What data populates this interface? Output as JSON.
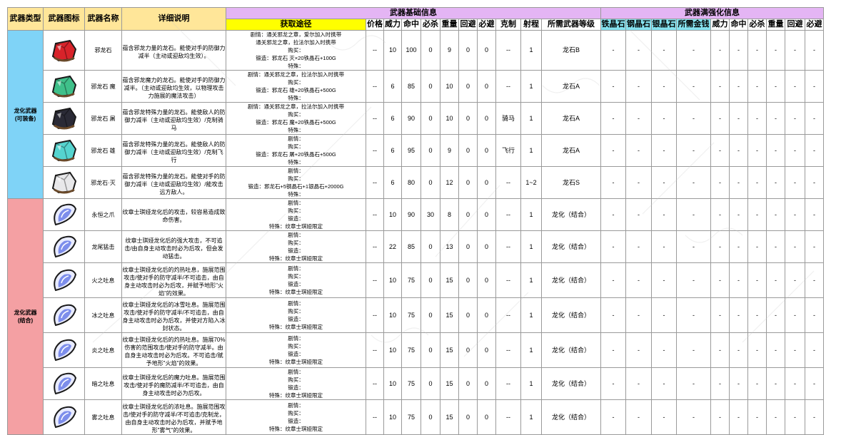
{
  "headers": {
    "type": "武器类型",
    "icon": "武器图标",
    "name": "武器名称",
    "desc": "详细说明",
    "basic_group": "武器基础信息",
    "enhance_group": "武器满强化信息",
    "route": "获取途径",
    "basic_cols": [
      "价格",
      "威力",
      "命中",
      "必杀",
      "重量",
      "回避",
      "必避",
      "克制",
      "射程",
      "所需武器等级"
    ],
    "enhance_cols": [
      "铁晶石",
      "钢晶石",
      "银晶石",
      "所需金钱",
      "威力",
      "命中",
      "必杀",
      "重量",
      "回避",
      "必避"
    ]
  },
  "categories": [
    {
      "label": "龙化武器\n(可装备)",
      "color": "#7fd3f7"
    },
    {
      "label": "龙化武器\n(结合)",
      "color": "#f4a0a3"
    }
  ],
  "route_labels": [
    "剧情：",
    "购买：",
    "锻造：",
    "特殊："
  ],
  "rows": [
    {
      "cat": 0,
      "icon": "red-dragonstone-icon",
      "gem": "#d8232a",
      "name": "邪龙石",
      "desc": "蕴含邪龙力量的龙石。能使对手的防御力减半（主动或迎敌均生效）。",
      "route": [
        "通关邪龙之章，爱尔加入时携带\n通关邪龙之章，拉法尔加入时携带",
        "",
        "邪龙石 灭×20铁晶石+100G",
        ""
      ],
      "basic": [
        "--",
        "10",
        "100",
        "0",
        "9",
        "0",
        "0",
        "--",
        "1",
        "龙石B"
      ],
      "enh": [
        "-",
        "-",
        "-",
        "-",
        "-",
        "-",
        "-",
        "-",
        "-",
        "-"
      ]
    },
    {
      "cat": 0,
      "icon": "green-dragonstone-icon",
      "gem": "#3fc08a",
      "name": "邪龙石 魔",
      "desc": "蕴含邪龙魔力的龙石。能使对手的防御力减半。（主动或迎敌均生效，以物理攻击力施展的魔法攻击）",
      "route": [
        "通关邪龙之章，拉法尔加入时携带",
        "",
        "邪龙石 雄+20铁晶石+500G",
        ""
      ],
      "basic": [
        "--",
        "6",
        "85",
        "0",
        "10",
        "0",
        "0",
        "--",
        "1",
        "龙石A"
      ],
      "enh": [
        "-",
        "-",
        "-",
        "-",
        "-",
        "-",
        "-",
        "-",
        "-",
        "-"
      ]
    },
    {
      "cat": 0,
      "icon": "black-dragonstone-icon",
      "gem": "#2a2a36",
      "name": "邪龙石 屠",
      "desc": "蕴含邪龙特殊力量的龙石。能使敌人的防御力减半（主动或迎敌均生效）/克制骑马",
      "route": [
        "通关邪龙之章，拉法尔加入时携带",
        "",
        "邪龙石 魔+20铁晶石+500G",
        ""
      ],
      "basic": [
        "--",
        "6",
        "90",
        "0",
        "10",
        "0",
        "0",
        "骑马",
        "1",
        "龙石A"
      ],
      "enh": [
        "-",
        "-",
        "-",
        "-",
        "-",
        "-",
        "-",
        "-",
        "-",
        "-"
      ]
    },
    {
      "cat": 0,
      "icon": "teal-dragonstone-icon",
      "gem": "#55d4cf",
      "name": "邪龙石 雄",
      "desc": "蕴含邪龙特殊力量的龙石。能使敌人的防御力减半（主动或迎敌均生效）/克制飞行",
      "route": [
        "",
        "",
        "邪龙石 屠+20铁晶石+500G",
        ""
      ],
      "basic": [
        "--",
        "6",
        "95",
        "0",
        "9",
        "0",
        "0",
        "飞行",
        "1",
        "龙石A"
      ],
      "enh": [
        "-",
        "-",
        "-",
        "-",
        "-",
        "-",
        "-",
        "-",
        "-",
        "-"
      ]
    },
    {
      "cat": 0,
      "icon": "white-dragonstone-icon",
      "gem": "#e8e8ea",
      "name": "邪龙石·灭",
      "desc": "蕴含邪龙特殊力量的龙石。能使对手的防御力减半（主动或迎敌均生效）/能攻击远方敌人。",
      "route": [
        "",
        "",
        "邪龙石+5钢晶石+1银晶石+2000G",
        ""
      ],
      "basic": [
        "--",
        "6",
        "80",
        "0",
        "12",
        "0",
        "0",
        "--",
        "1~2",
        "龙石S"
      ],
      "enh": [
        "-",
        "-",
        "-",
        "-",
        "-",
        "-",
        "-",
        "-",
        "-",
        "-"
      ]
    },
    {
      "cat": 1,
      "icon": "dragon-scale-icon",
      "gem": "#6a7ee8",
      "name": "永恒之爪",
      "desc": "纹章士琪娅龙化后的攻击，较容易造成致命伤害。",
      "route": [
        "",
        "",
        "",
        "纹章士琪娅限定"
      ],
      "basic": [
        "--",
        "10",
        "90",
        "30",
        "8",
        "0",
        "0",
        "--",
        "1",
        "龙化（结合）"
      ],
      "enh": [
        "-",
        "-",
        "-",
        "-",
        "-",
        "-",
        "-",
        "-",
        "-",
        "-"
      ]
    },
    {
      "cat": 1,
      "icon": "dragon-scale-icon",
      "gem": "#6a7ee8",
      "name": "龙尾猛击",
      "desc": "纹章士琪娅龙化后的强大攻击，不可追击/由自身主动攻击时必为后攻，但会发动猛击。",
      "route": [
        "",
        "",
        "",
        "纹章士琪娅限定"
      ],
      "basic": [
        "--",
        "22",
        "85",
        "0",
        "13",
        "0",
        "0",
        "--",
        "1",
        "龙化（结合）"
      ],
      "enh": [
        "-",
        "-",
        "-",
        "-",
        "-",
        "-",
        "-",
        "-",
        "-",
        "-"
      ]
    },
    {
      "cat": 1,
      "icon": "dragon-scale-icon",
      "gem": "#6a7ee8",
      "name": "火之吐息",
      "desc": "纹章士琪娅龙化后的灼热吐息，施展范围攻击/使对手的防守减半/不可追击，由自身主动攻击时必为后攻，并赋予地形\"火焰\"的效果。",
      "route": [
        "",
        "",
        "",
        "纹章士琪娅限定"
      ],
      "basic": [
        "--",
        "10",
        "75",
        "0",
        "15",
        "0",
        "0",
        "--",
        "1",
        "龙化（结合）"
      ],
      "enh": [
        "-",
        "-",
        "-",
        "-",
        "-",
        "-",
        "-",
        "-",
        "-",
        "-"
      ]
    },
    {
      "cat": 1,
      "icon": "dragon-scale-icon",
      "gem": "#6a7ee8",
      "name": "冰之吐息",
      "desc": "纹章士琪娅龙化后的冰雪吐息。施展范围攻击/使对手的防守减半/不可追击，由自身主动攻击时必为后攻，并使对方陷入冰封状态。",
      "route": [
        "",
        "",
        "",
        "纹章士琪娅限定"
      ],
      "basic": [
        "--",
        "10",
        "75",
        "0",
        "15",
        "0",
        "0",
        "--",
        "1",
        "龙化（结合）"
      ],
      "enh": [
        "-",
        "-",
        "-",
        "-",
        "-",
        "-",
        "-",
        "-",
        "-",
        "-"
      ]
    },
    {
      "cat": 1,
      "icon": "dragon-scale-icon",
      "gem": "#6a7ee8",
      "name": "炎之吐息",
      "desc": "纹章士琪娅龙化后的灼热吐息。施展70%伤害的范围攻击/使对手的防守减半。由自身主动攻击时必为后攻。不可追击/赋予地形\"火焰\"的效果。",
      "route": [
        "",
        "",
        "",
        "纹章士琪娅限定"
      ],
      "basic": [
        "--",
        "10",
        "75",
        "0",
        "15",
        "0",
        "0",
        "--",
        "1",
        "龙化（结合）"
      ],
      "enh": [
        "-",
        "-",
        "-",
        "-",
        "-",
        "-",
        "-",
        "-",
        "-",
        "-"
      ]
    },
    {
      "cat": 1,
      "icon": "dragon-scale-icon",
      "gem": "#6a7ee8",
      "name": "暗之吐息",
      "desc": "纹章士琪娅龙化后的魔力吐息。施展范围攻击/使对手的魔防减半/不可追击，由自身主动攻击时必为后攻。",
      "route": [
        "",
        "",
        "",
        "纹章士琪娅限定"
      ],
      "basic": [
        "--",
        "10",
        "75",
        "0",
        "15",
        "0",
        "0",
        "--",
        "1",
        "龙化（结合）"
      ],
      "enh": [
        "-",
        "-",
        "-",
        "-",
        "-",
        "-",
        "-",
        "-",
        "-",
        "-"
      ]
    },
    {
      "cat": 1,
      "icon": "dragon-scale-icon",
      "gem": "#6a7ee8",
      "name": "雾之吐息",
      "desc": "纹章士琪娅龙化后的浓吐息。施展范围攻击/使对手的防守减半/不可追击/克制龙，由自身主动攻击时必为后攻，并赋予地形\"雾气\"的效果。",
      "route": [
        "",
        "",
        "",
        "纹章士琪娅限定"
      ],
      "basic": [
        "--",
        "10",
        "75",
        "0",
        "15",
        "0",
        "0",
        "--",
        "1",
        "龙化（结合）"
      ],
      "enh": [
        "-",
        "-",
        "-",
        "-",
        "-",
        "-",
        "-",
        "-",
        "-",
        "-"
      ]
    }
  ]
}
